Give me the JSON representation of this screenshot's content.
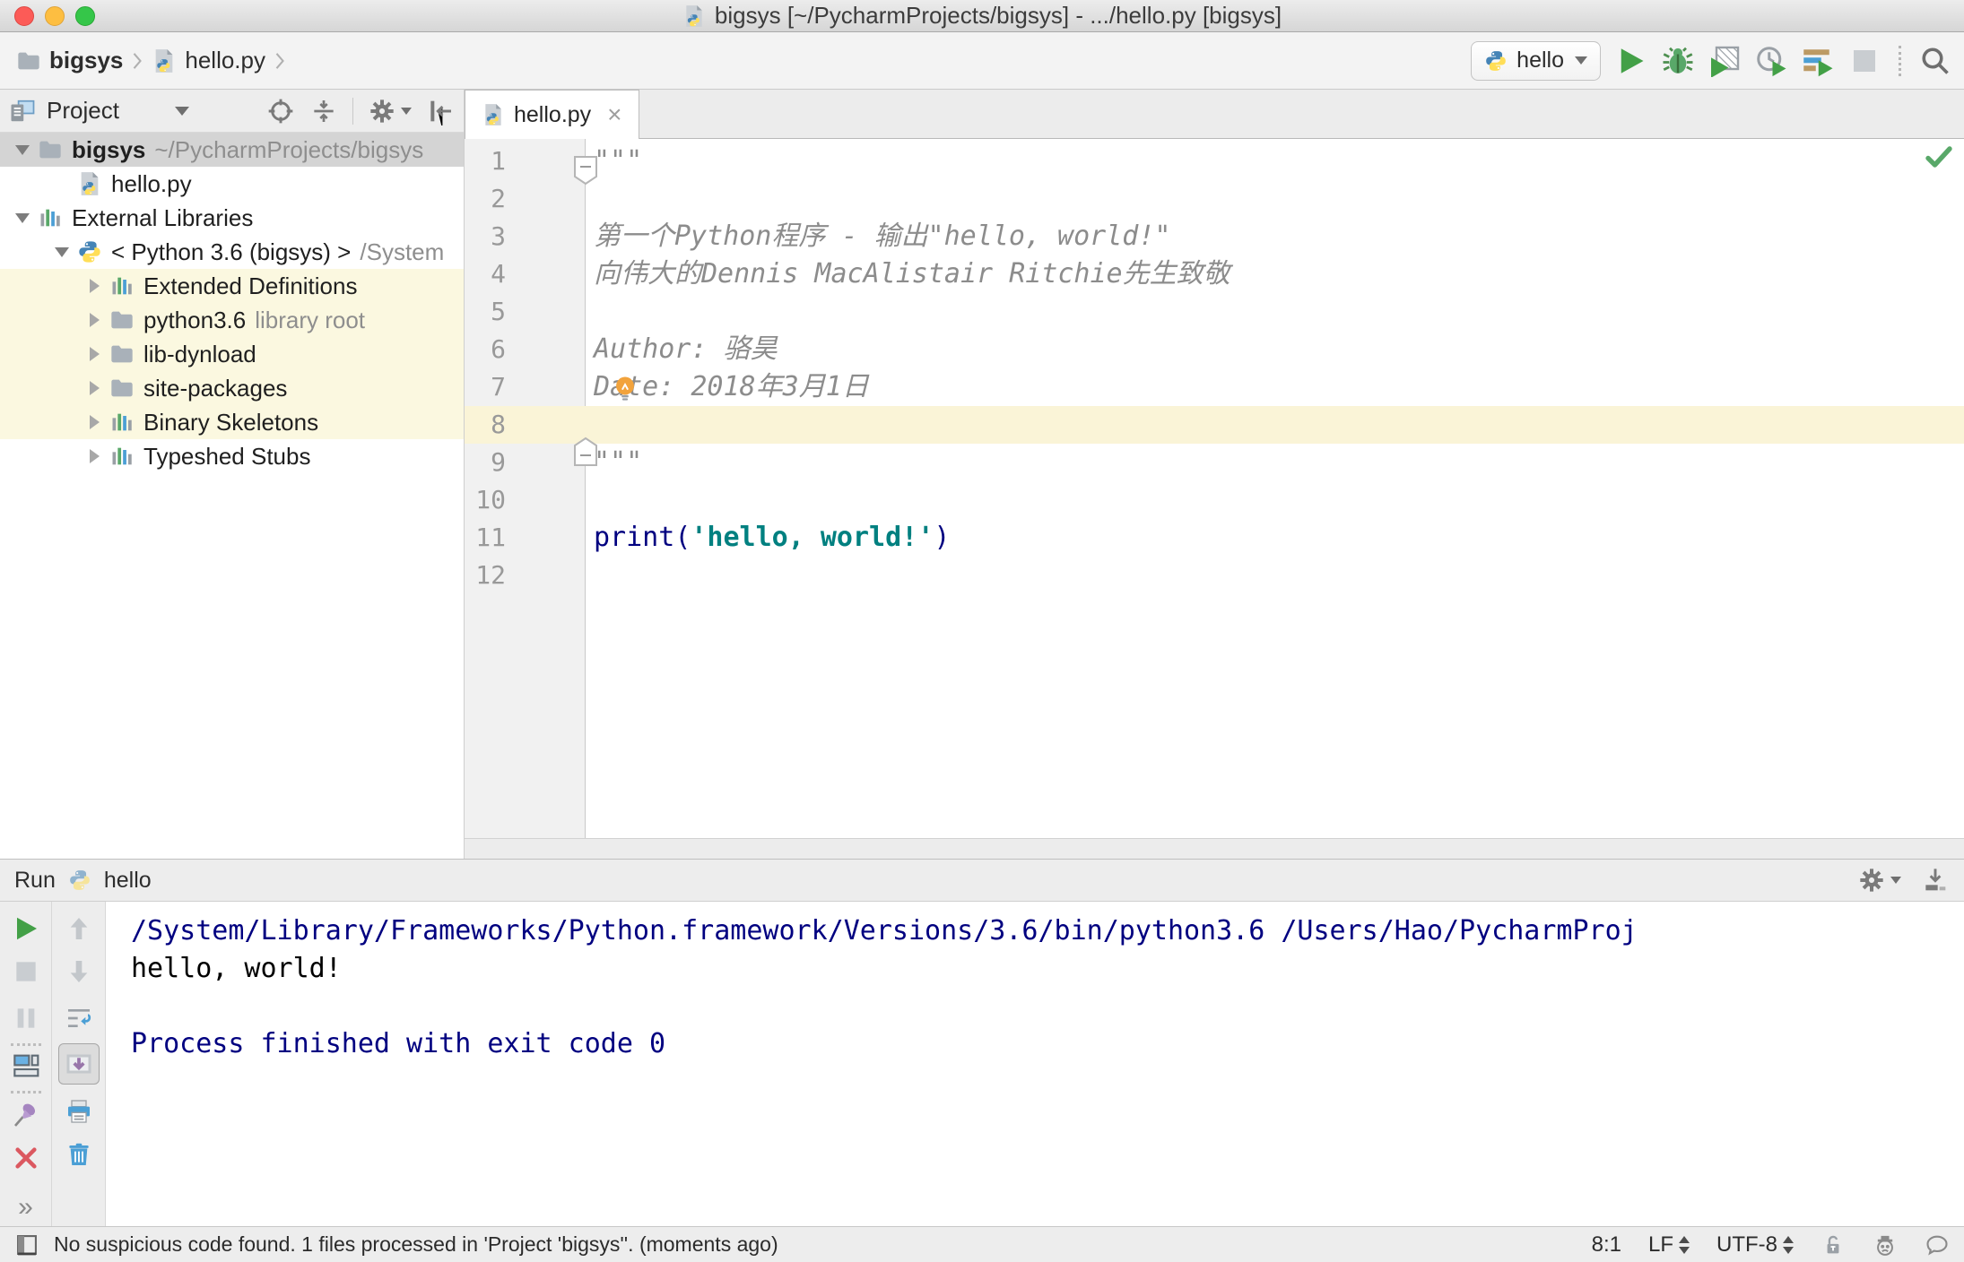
{
  "window": {
    "title": "bigsys [~/PycharmProjects/bigsys] - .../hello.py [bigsys]"
  },
  "navbar": {
    "breadcrumbs": [
      {
        "label": "bigsys",
        "icon": "folder",
        "bold": true
      },
      {
        "label": "hello.py",
        "icon": "pyfile",
        "bold": false
      }
    ],
    "run_config": {
      "label": "hello"
    }
  },
  "project_panel": {
    "title": "Project",
    "tree": [
      {
        "label": "bigsys",
        "suffix": "~/PycharmProjects/bigsys",
        "icon": "folder",
        "arrow": "open",
        "level": 0,
        "state": "selected",
        "bold": true
      },
      {
        "label": "hello.py",
        "suffix": "",
        "icon": "pyfile",
        "arrow": "none",
        "level": 1,
        "state": "",
        "bold": false
      },
      {
        "label": "External Libraries",
        "suffix": "",
        "icon": "library",
        "arrow": "open",
        "level": 0,
        "state": "",
        "bold": false
      },
      {
        "label": "< Python 3.6 (bigsys) >",
        "suffix": "/System",
        "icon": "python",
        "arrow": "open",
        "level": 1,
        "state": "",
        "bold": false
      },
      {
        "label": "Extended Definitions",
        "suffix": "",
        "icon": "library",
        "arrow": "closed",
        "level": 2,
        "state": "highlighted",
        "bold": false
      },
      {
        "label": "python3.6",
        "suffix": "library root",
        "icon": "folder",
        "arrow": "closed",
        "level": 2,
        "state": "highlighted",
        "bold": false
      },
      {
        "label": "lib-dynload",
        "suffix": "",
        "icon": "folder",
        "arrow": "closed",
        "level": 2,
        "state": "highlighted",
        "bold": false
      },
      {
        "label": "site-packages",
        "suffix": "",
        "icon": "folder",
        "arrow": "closed",
        "level": 2,
        "state": "highlighted",
        "bold": false
      },
      {
        "label": "Binary Skeletons",
        "suffix": "",
        "icon": "library",
        "arrow": "closed",
        "level": 2,
        "state": "highlighted",
        "bold": false
      },
      {
        "label": "Typeshed Stubs",
        "suffix": "",
        "icon": "library",
        "arrow": "closed",
        "level": 2,
        "state": "",
        "bold": false
      }
    ]
  },
  "editor": {
    "tab": {
      "label": "hello.py",
      "close_glyph": "×"
    },
    "caret_line": 8,
    "lines": [
      {
        "num": 1,
        "caret": false,
        "segments": [
          {
            "text": "\"\"\"",
            "style": "doc"
          }
        ]
      },
      {
        "num": 2,
        "caret": false,
        "segments": []
      },
      {
        "num": 3,
        "caret": false,
        "segments": [
          {
            "text": "第一个Python程序 - 输出\"hello, world!\"",
            "style": "doc"
          }
        ]
      },
      {
        "num": 4,
        "caret": false,
        "segments": [
          {
            "text": "向伟大的Dennis MacAlistair Ritchie先生致敬",
            "style": "doc"
          }
        ]
      },
      {
        "num": 5,
        "caret": false,
        "segments": []
      },
      {
        "num": 6,
        "caret": false,
        "segments": [
          {
            "text": "Author: 骆昊",
            "style": "doc"
          }
        ]
      },
      {
        "num": 7,
        "caret": false,
        "segments": [
          {
            "text": "Date: 2018年3月1日",
            "style": "doc"
          }
        ]
      },
      {
        "num": 8,
        "caret": true,
        "segments": []
      },
      {
        "num": 9,
        "caret": false,
        "segments": [
          {
            "text": "\"\"\"",
            "style": "doc"
          }
        ]
      },
      {
        "num": 10,
        "caret": false,
        "segments": []
      },
      {
        "num": 11,
        "caret": false,
        "segments": [
          {
            "text": "print",
            "style": "kw"
          },
          {
            "text": "(",
            "style": "kw"
          },
          {
            "text": "'hello, world!'",
            "style": "str"
          },
          {
            "text": ")",
            "style": "kw"
          }
        ]
      },
      {
        "num": 12,
        "caret": false,
        "segments": []
      }
    ]
  },
  "run_panel": {
    "label": "Run",
    "config": "hello",
    "more_label": "»",
    "console": [
      {
        "text": "/System/Library/Frameworks/Python.framework/Versions/3.6/bin/python3.6 /Users/Hao/PycharmProj",
        "style": "sys"
      },
      {
        "text": "hello, world!",
        "style": "out"
      },
      {
        "text": "",
        "style": "out"
      },
      {
        "text": "Process finished with exit code 0",
        "style": "sys"
      }
    ]
  },
  "status_bar": {
    "message": "No suspicious code found. 1 files processed in 'Project 'bigsys''. (moments ago)",
    "position": "8:1",
    "line_separator": "LF",
    "encoding": "UTF-8"
  },
  "colors": {
    "accent_green": "#43a047",
    "selection_gray": "#d4d4d4",
    "tree_highlight": "#fbf8e0",
    "caret_line": "#faf4d7",
    "keyword": "#000080",
    "string": "#008080",
    "comment": "#8c8c8c"
  },
  "icons": {
    "run": "green-play-triangle",
    "debug": "green-bug",
    "coverage": "hatched-square-with-play",
    "profiler": "clock-with-play",
    "concurrency": "bars-with-play",
    "stop": "gray-square",
    "pause": "gray-pause-bars",
    "search": "magnifier",
    "settings": "gear",
    "locate": "crosshair-target",
    "collapse_all": "arrows-to-line",
    "hide": "bar-with-left-arrow",
    "pin": "purple-pushpin",
    "close": "red-x",
    "soft_wrap": "wrap-arrows",
    "scroll_to_end": "window-down-arrow",
    "print": "printer",
    "clear": "trash-can",
    "lightbulb": "intention-bulb",
    "ok_check": "green-check",
    "lock": "unlocked-padlock",
    "hector": "inspector-face",
    "feedback": "speech-bubble"
  }
}
